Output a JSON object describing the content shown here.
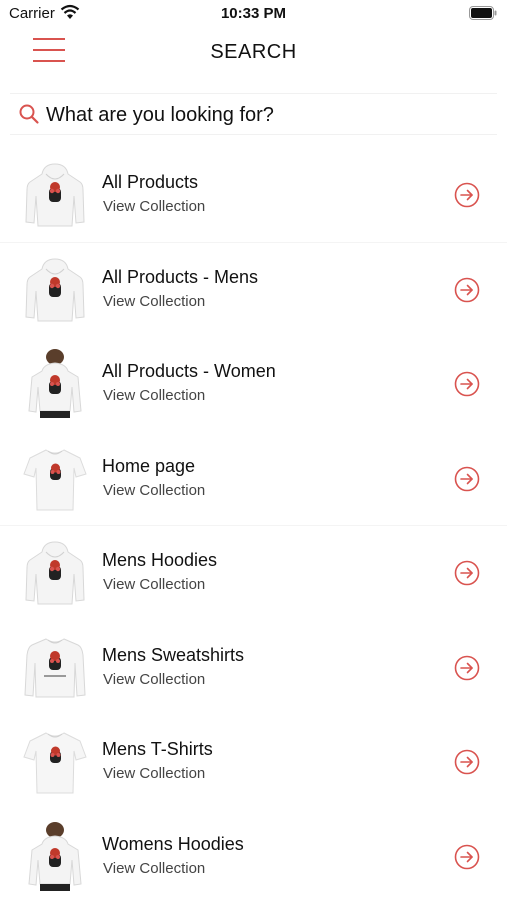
{
  "status_bar": {
    "carrier": "Carrier",
    "time": "10:33 PM"
  },
  "header": {
    "title": "SEARCH"
  },
  "search": {
    "placeholder": "What are you looking for?"
  },
  "collections": [
    {
      "title": "All Products",
      "subtitle": "View Collection",
      "thumb": "hoodie"
    },
    {
      "title": "All Products - Mens",
      "subtitle": "View Collection",
      "thumb": "hoodie"
    },
    {
      "title": "All Products - Women",
      "subtitle": "View Collection",
      "thumb": "woman-hoodie"
    },
    {
      "title": "Home page",
      "subtitle": "View Collection",
      "thumb": "tshirt"
    },
    {
      "title": "Mens Hoodies",
      "subtitle": "View Collection",
      "thumb": "hoodie"
    },
    {
      "title": "Mens Sweatshirts",
      "subtitle": "View Collection",
      "thumb": "sweatshirt"
    },
    {
      "title": "Mens T-Shirts",
      "subtitle": "View Collection",
      "thumb": "tshirt"
    },
    {
      "title": "Womens Hoodies",
      "subtitle": "View Collection",
      "thumb": "woman-hoodie"
    }
  ],
  "colors": {
    "accent": "#d9534f",
    "text": "#111111",
    "subtext": "#444444"
  }
}
